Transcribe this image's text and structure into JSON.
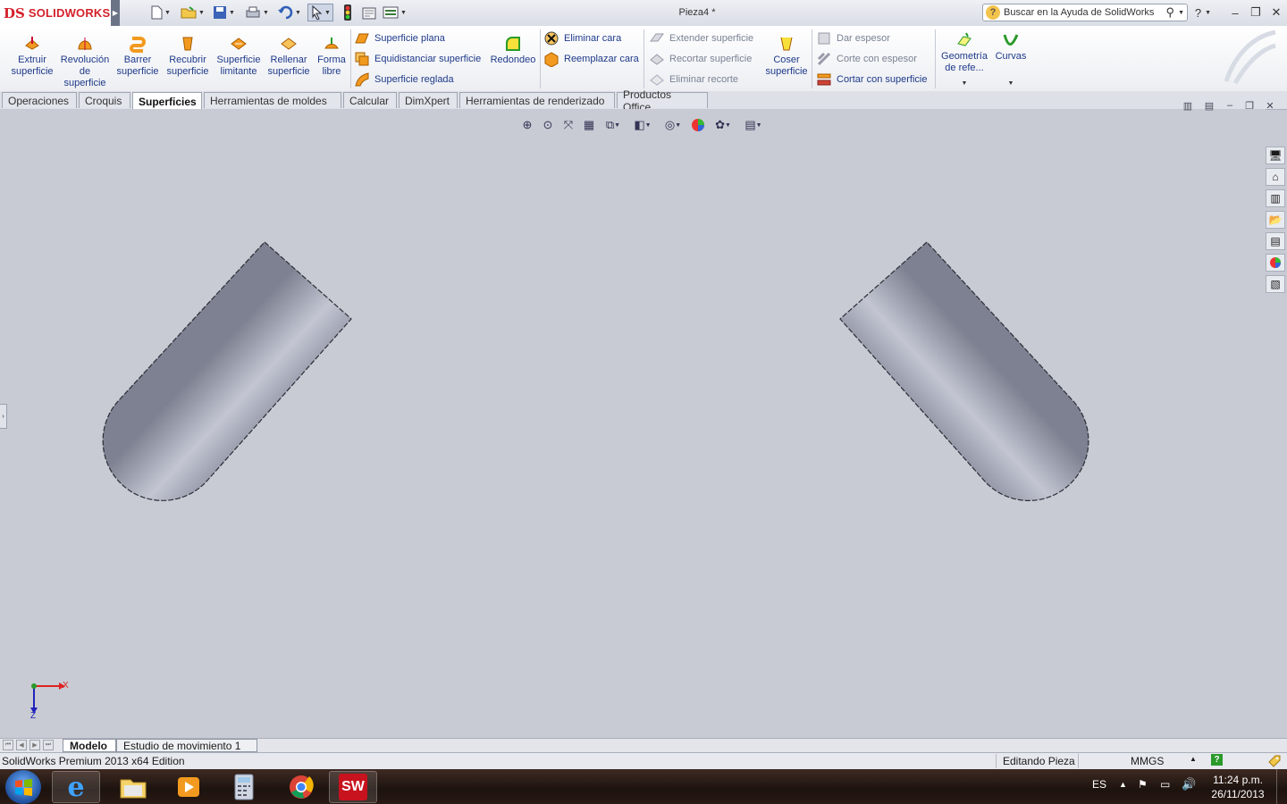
{
  "app": {
    "brand_mark": "DS",
    "brand_name": "SOLIDWORKS",
    "window_title": "Pieza4 *"
  },
  "help": {
    "search_placeholder": "Buscar en la Ayuda de SolidWorks"
  },
  "ribbon": {
    "big": [
      {
        "label": "Extruir superficie",
        "icon": "extrude-surface-icon"
      },
      {
        "label": "Revolución de superficie",
        "icon": "revolve-surface-icon"
      },
      {
        "label": "Barrer superficie",
        "icon": "sweep-surface-icon"
      },
      {
        "label": "Recubrir superficie",
        "icon": "loft-surface-icon"
      },
      {
        "label": "Superficie limitante",
        "icon": "boundary-surface-icon"
      },
      {
        "label": "Rellenar superficie",
        "icon": "fill-surface-icon"
      },
      {
        "label": "Forma libre",
        "icon": "freeform-icon"
      }
    ],
    "group1": [
      "Superficie plana",
      "Equidistanciar superficie",
      "Superficie reglada"
    ],
    "fillet": "Redondeo",
    "group2": [
      "Eliminar cara",
      "Reemplazar cara"
    ],
    "group3": [
      "Extender superficie",
      "Recortar superficie",
      "Eliminar recorte"
    ],
    "knit": "Coser superficie",
    "group4": [
      "Dar espesor",
      "Corte con espesor",
      "Cortar con superficie"
    ],
    "refgeom": "Geometría de refe...",
    "curves": "Curvas"
  },
  "tabs": [
    "Operaciones",
    "Croquis",
    "Superficies",
    "Herramientas de moldes",
    "Calcular",
    "DimXpert",
    "Herramientas de renderizado",
    "Productos Office"
  ],
  "active_tab": "Superficies",
  "triad": {
    "x": "X",
    "y": "Y",
    "z": "Z"
  },
  "model_tabs": [
    "Modelo",
    "Estudio de movimiento 1"
  ],
  "status": {
    "edition": "SolidWorks Premium 2013 x64 Edition",
    "mode": "Editando Pieza",
    "units": "MMGS",
    "help": "?"
  },
  "taskbar": {
    "lang": "ES",
    "time": "11:24 p.m.",
    "date": "26/11/2013"
  },
  "colors": {
    "ribbon_text": "#1e3a8a",
    "brand_red": "#d4202a",
    "viewport_bg": "#c8cbd3",
    "shape": "#9a9eae"
  }
}
